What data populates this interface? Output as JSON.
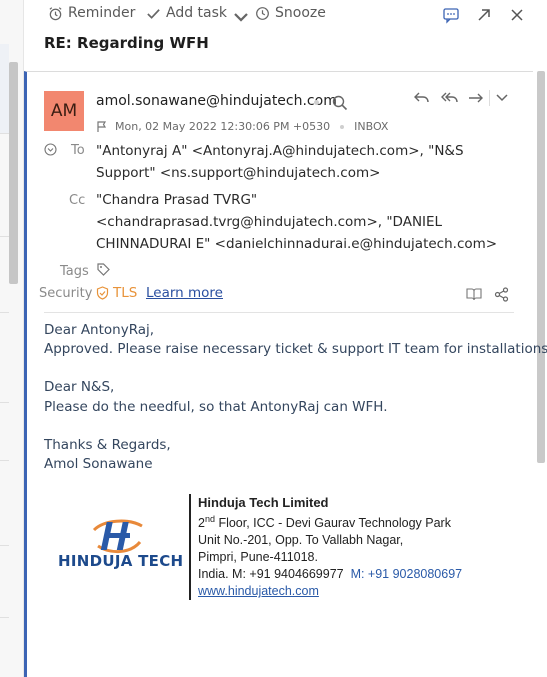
{
  "toolbar": {
    "reminder_label": "Reminder",
    "add_task_label": "Add task",
    "snooze_label": "Snooze"
  },
  "subject": "RE: Regarding WFH",
  "message": {
    "avatar_initials": "AM",
    "avatar_color": "#f2876f",
    "sender": "amol.sonawane@hindujatech.com",
    "date": "Mon, 02 May 2022 12:30:06 PM +0530",
    "folder": "INBOX",
    "to_label": "To",
    "to_value": "\"Antonyraj A\" <Antonyraj.A@hindujatech.com>, \"N&S Support\" <ns.support@hindujatech.com>",
    "cc_label": "Cc",
    "cc_value": "\"Chandra Prasad TVRG\" <chandraprasad.tvrg@hindujatech.com>, \"DANIEL CHINNADURAI E\" <danielchinnadurai.e@hindujatech.com>",
    "tags_label": "Tags",
    "security_label": "Security",
    "security_value": "TLS",
    "learn_more": "Learn more"
  },
  "body": {
    "line1": "Dear AntonyRaj,",
    "line2": "Approved. Please raise necessary ticket & support IT team for installations.",
    "line3": "Dear N&S,",
    "line4": "Please do the needful, so that AntonyRaj can WFH.",
    "line5": "Thanks & Regards,",
    "line6": "Amol Sonawane"
  },
  "signature": {
    "logo_text": "HINDUJA TECH",
    "company": "Hinduja Tech Limited",
    "floor_num": "2",
    "floor_sup": "nd",
    "address1": " Floor, ICC - Devi Gaurav Technology Park",
    "address2": "Unit No.-201, Opp. To Vallabh Nagar,",
    "address3": "Pimpri, Pune-411018.",
    "phone1": "India. M: +91 9404669977",
    "phone2": "M: +91 9028080697",
    "website": "www.hindujatech.com"
  },
  "colors": {
    "accent_border": "#3c64b4",
    "tls_orange": "#e8933a",
    "link_blue": "#2a4fa0"
  }
}
